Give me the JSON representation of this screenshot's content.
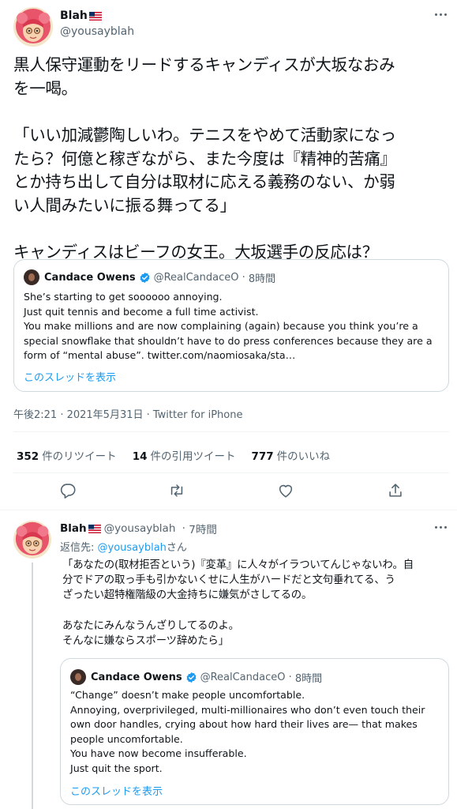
{
  "main_tweet": {
    "author_name": "Blah",
    "author_handle": "@yousayblah",
    "text": {
      "line1": "黒人保守運動をリードするキャンディスが大坂なおみ",
      "line2": "を一喝。",
      "line3": "「いい加減鬱陶しいわ。テニスをやめて活動家になっ",
      "line4": "たら？何億と稼ぎながら、また今度は『精神的苦痛』",
      "line5": "とか持ち出して自分は取材に応える義務のない、か弱",
      "line6": "い人間みたいに振る舞ってる」",
      "line7": "キャンディスはビーフの女王。大坂選手の反応は？"
    },
    "quoted": {
      "name": "Candace Owens",
      "handle": "@RealCandaceO",
      "time": "8時間",
      "line1": "She’s starting to get soooooo annoying.",
      "line2": "Just quit tennis and become a full time activist.",
      "line3": "You make millions and are now complaining (again) because you think you’re a",
      "line4": "special snowflake that shouldn’t have to do press conferences because they are a",
      "line5": "form of “mental abuse”. twitter.com/naomiosaka/sta…",
      "thread_link": "このスレッドを表示"
    },
    "timestamp": "午後2:21 · 2021年5月31日 · Twitter for iPhone",
    "stats": {
      "retweets_count": "352",
      "retweets_label": "件のリツイート",
      "quotes_count": "14",
      "quotes_label": "件の引用ツイート",
      "likes_count": "777",
      "likes_label": "件のいいね"
    }
  },
  "reply_tweet": {
    "author_name": "Blah",
    "author_handle": "@yousayblah",
    "time": "7時間",
    "reply_to_prefix": "返信先: ",
    "reply_to_handle": "@yousayblah",
    "reply_to_suffix": "さん",
    "text": {
      "line1": "「あなたの(取材拒否という)『変革』に人々がイラついてんじゃないわ。自",
      "line2": "分でドアの取っ手も引かないくせに人生がハードだと文句垂れてる、う",
      "line3": "ざったい超特権階級の大金持ちに嫌気がさしてるの。",
      "line4": "あなたにみんなうんざりしてるのよ。",
      "line5": "そんなに嫌ならスポーツ辞めたら」"
    },
    "quoted": {
      "name": "Candace Owens",
      "handle": "@RealCandaceO",
      "time": "8時間",
      "line1": "“Change” doesn’t make people uncomfortable.",
      "line2": "Annoying, overprivileged, multi-millionaires who don’t even touch their",
      "line3": "own door handles, crying about how hard their lives are— that makes",
      "line4": "people uncomfortable.",
      "line5": "You have now become insufferable.",
      "line6": "Just quit the sport.",
      "thread_link": "このスレッドを表示"
    }
  },
  "icons": {
    "reply": "reply-icon",
    "retweet": "retweet-icon",
    "like": "heart-icon",
    "share": "share-icon",
    "more": "more-icon",
    "verified": "verified-badge-icon",
    "flag": "us-flag-icon"
  },
  "colors": {
    "accent": "#1d9bf0",
    "secondary_text": "#536471",
    "border": "#cfd9de"
  }
}
